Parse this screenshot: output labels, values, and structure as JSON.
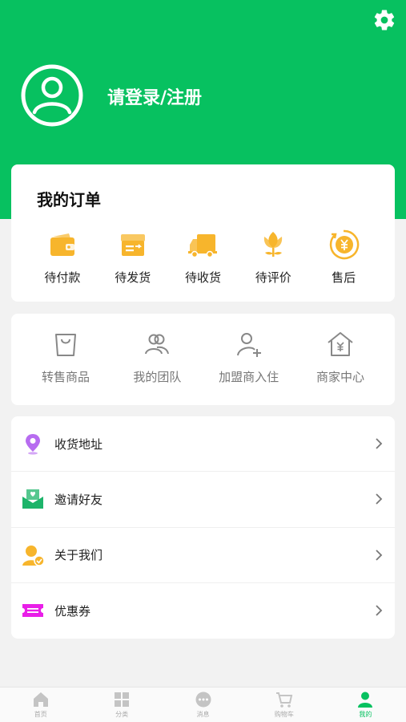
{
  "header": {
    "login_label": "请登录/注册",
    "settings_icon": "gear-icon",
    "avatar_icon": "user-avatar-icon",
    "bg_color": "#07c160"
  },
  "orders": {
    "title": "我的订单",
    "items": [
      {
        "label": "待付款",
        "icon": "wallet-icon"
      },
      {
        "label": "待发货",
        "icon": "box-icon"
      },
      {
        "label": "待收货",
        "icon": "truck-icon"
      },
      {
        "label": "待评价",
        "icon": "flower-icon"
      },
      {
        "label": "售后",
        "icon": "yen-coin-icon"
      }
    ],
    "accent": "#f7b52c"
  },
  "services": {
    "items": [
      {
        "label": "转售商品",
        "icon": "bag-icon"
      },
      {
        "label": "我的团队",
        "icon": "team-icon"
      },
      {
        "label": "加盟商入住",
        "icon": "user-add-icon"
      },
      {
        "label": "商家中心",
        "icon": "store-icon"
      }
    ]
  },
  "menu": {
    "items": [
      {
        "label": "收货地址",
        "icon": "location-pin-icon",
        "color": "#b76cf0"
      },
      {
        "label": "邀请好友",
        "icon": "invite-envelope-icon",
        "color": "#1db46a"
      },
      {
        "label": "关于我们",
        "icon": "about-user-icon",
        "color": "#f7b52c"
      },
      {
        "label": "优惠券",
        "icon": "coupon-icon",
        "color": "#e91ee8"
      }
    ]
  },
  "tabbar": {
    "items": [
      {
        "label": "首页",
        "icon": "home-icon"
      },
      {
        "label": "分类",
        "icon": "category-grid-icon"
      },
      {
        "label": "消息",
        "icon": "message-icon"
      },
      {
        "label": "购物车",
        "icon": "cart-icon"
      },
      {
        "label": "我的",
        "icon": "profile-icon",
        "active": true
      }
    ],
    "active_color": "#07c160"
  }
}
